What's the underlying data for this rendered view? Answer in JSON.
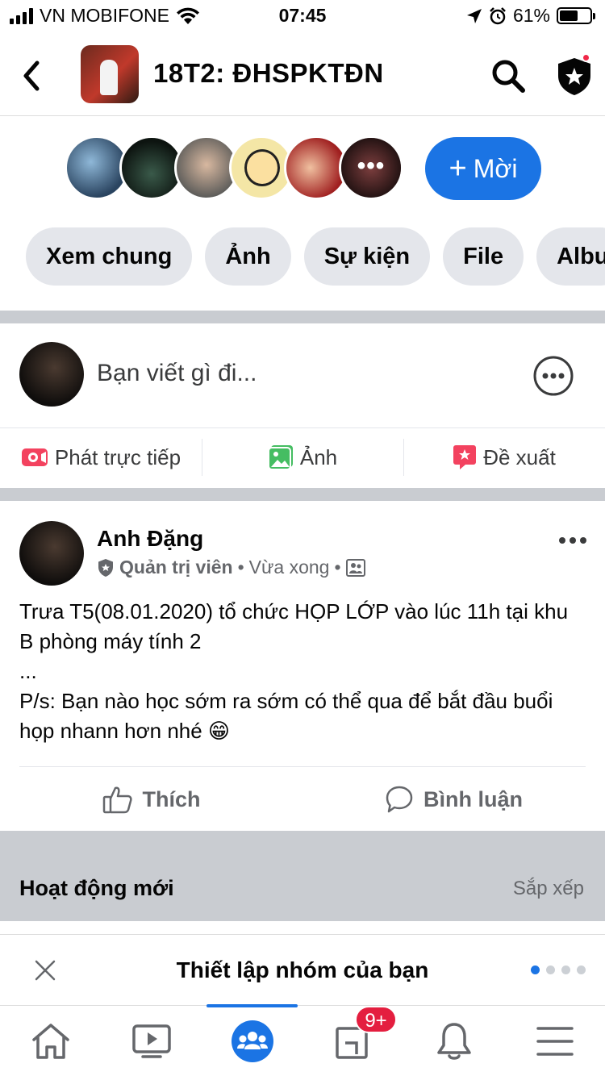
{
  "status_bar": {
    "carrier": "VN MOBIFONE",
    "time": "07:45",
    "battery": "61%",
    "battery_level": 0.61
  },
  "header": {
    "group_name": "18T2: ĐHSPKTĐN"
  },
  "members": {
    "more_label": "•••",
    "invite_plus": "+",
    "invite_label": "Mời"
  },
  "tabs": [
    "Xem chung",
    "Ảnh",
    "Sự kiện",
    "File",
    "Albu"
  ],
  "composer": {
    "placeholder": "Bạn viết gì đi..."
  },
  "composer_actions": {
    "live": "Phát trực tiếp",
    "photo": "Ảnh",
    "suggest": "Đề xuất"
  },
  "post": {
    "author": "Anh Đặng",
    "role": "Quản trị viên",
    "separator": "•",
    "time": "Vừa xong",
    "text": "Trưa T5(08.01.2020) tổ chức HỌP LỚP vào lúc 11h tại khu B phòng máy tính 2\n...\nP/s: Bạn nào học sớm ra sớm có thể qua để bắt đầu buổi họp nhann hơn nhé 😁",
    "like": "Thích",
    "comment": "Bình luận"
  },
  "activity": {
    "title": "Hoạt động mới",
    "sort": "Sắp xếp"
  },
  "setup": {
    "title": "Thiết lập nhóm của bạn"
  },
  "tab_bar": {
    "notifications_badge": "9+"
  },
  "colors": {
    "accent": "#1b74e4",
    "badge": "#e41e3f",
    "live": "#f3425f",
    "photo": "#45bd62"
  }
}
